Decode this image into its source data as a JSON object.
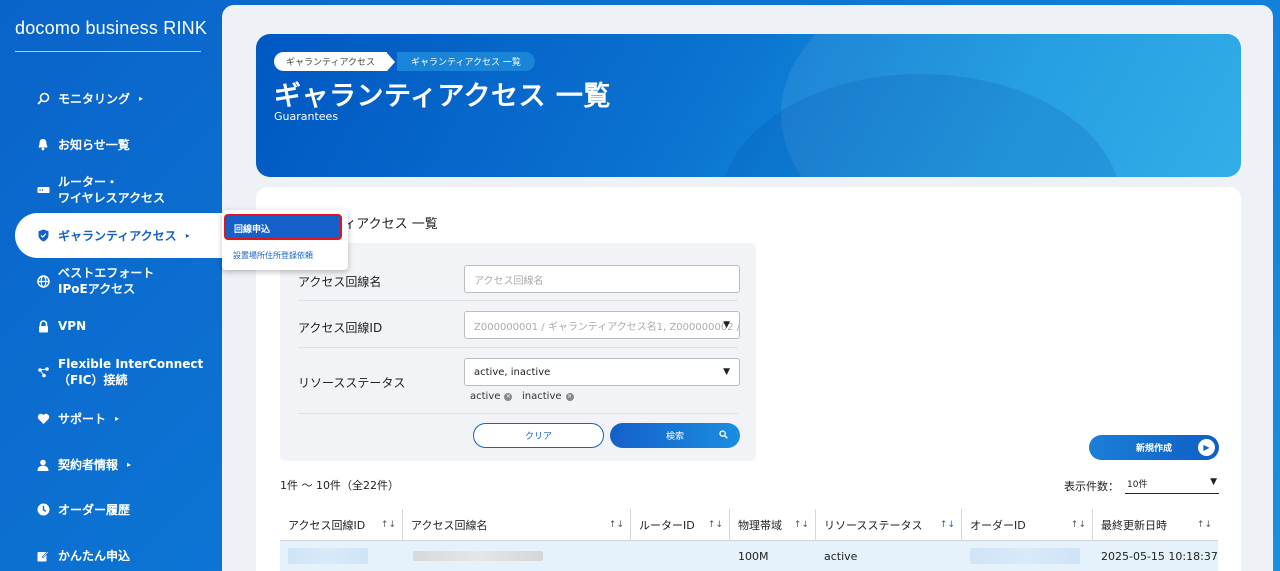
{
  "brand": "docomo business RINK",
  "sidebar": {
    "items": [
      {
        "label": "モニタリング",
        "icon": "search-icon",
        "has_arrow": true
      },
      {
        "label": "お知らせ一覧",
        "icon": "bell-icon",
        "has_arrow": false
      },
      {
        "label_line1": "ルーター・",
        "label_line2": "ワイヤレスアクセス",
        "icon": "router-icon",
        "has_arrow": false
      },
      {
        "label": "ギャランティアクセス",
        "icon": "shield-icon",
        "has_arrow": true,
        "active": true
      },
      {
        "label_line1": "ベストエフォート",
        "label_line2": "IPoEアクセス",
        "icon": "globe-icon",
        "has_arrow": false
      },
      {
        "label": "VPN",
        "icon": "lock-icon",
        "has_arrow": false
      },
      {
        "label_line1": "Flexible InterConnect",
        "label_line2": "（FIC）接続",
        "icon": "network-icon",
        "has_arrow": false
      },
      {
        "label": "サポート",
        "icon": "support-icon",
        "has_arrow": true
      },
      {
        "label": "契約者情報",
        "icon": "user-icon",
        "has_arrow": true
      },
      {
        "label": "オーダー履歴",
        "icon": "clock-icon",
        "has_arrow": false
      },
      {
        "label": "かんたん申込",
        "icon": "edit-icon",
        "has_arrow": false
      }
    ],
    "arrow": "▸"
  },
  "submenu": {
    "primary": "回線申込",
    "secondary": "設置場所住所登録依頼"
  },
  "hero": {
    "breadcrumb": [
      "ギャランティアクセス",
      "ギャランティアクセス 一覧"
    ],
    "title": "ギャランティアクセス 一覧",
    "subtitle": "Guarantees"
  },
  "card": {
    "title": "ティアクセス 一覧"
  },
  "search": {
    "fields": [
      {
        "label": "アクセス回線名",
        "placeholder": "アクセス回線名"
      },
      {
        "label": "アクセス回線ID",
        "placeholder": "Z000000001 / ギャランティアクセス名1, Z000000002 / ギ"
      },
      {
        "label": "リソースステータス",
        "value": "active, inactive"
      }
    ],
    "chips": [
      "active",
      "inactive"
    ],
    "clear_label": "クリア",
    "search_label": "検索"
  },
  "new_button": "新規作成",
  "result_count": "1件 〜 10件（全22件）",
  "page_size_label": "表示件数：",
  "page_size_value": "10件",
  "table": {
    "columns": [
      "アクセス回線ID",
      "アクセス回線名",
      "ルーターID",
      "物理帯域",
      "リソースステータス",
      "オーダーID",
      "最終更新日時"
    ],
    "sort_icon": "↑↓",
    "rows": [
      {
        "bandwidth": "100M",
        "status": "active",
        "updated": "2025-05-15 10:18:37"
      }
    ]
  }
}
